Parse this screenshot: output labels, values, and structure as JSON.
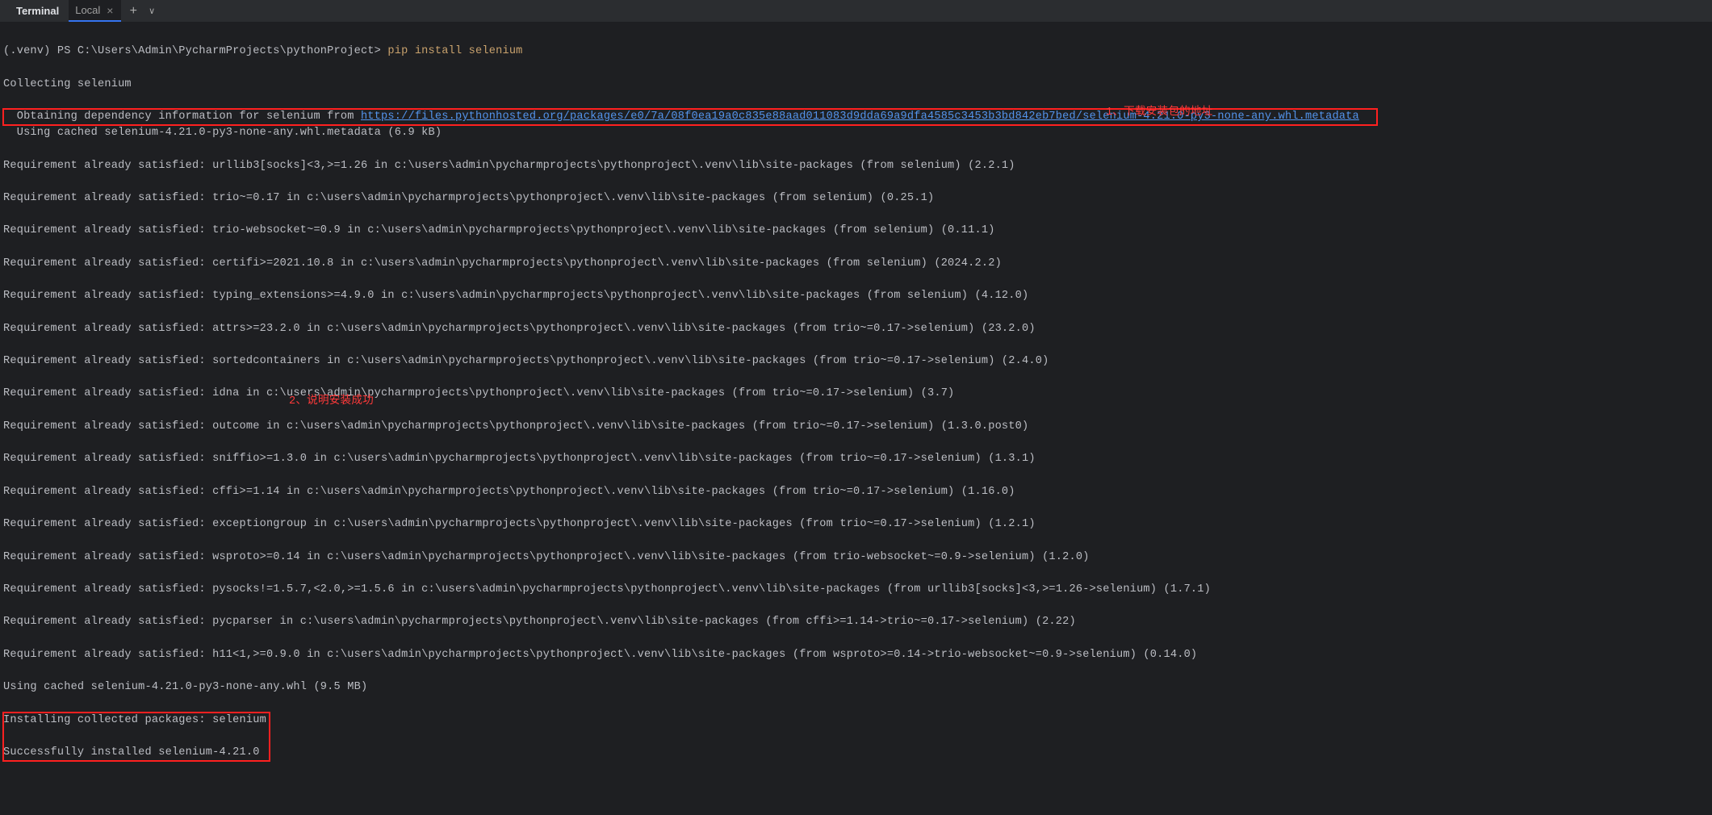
{
  "tabbar": {
    "title": "Terminal",
    "tab_label": "Local",
    "close_glyph": "×",
    "plus_glyph": "+",
    "chevron_glyph": "∨"
  },
  "prompt": {
    "prefix": "(.venv) PS C:\\Users\\Admin\\PycharmProjects\\pythonProject> ",
    "command": "pip install selenium"
  },
  "lines": {
    "collecting": "Collecting selenium",
    "obtaining_prefix": "  Obtaining dependency information for selenium from ",
    "obtaining_url": "https://files.pythonhosted.org/packages/e0/7a/08f0ea19a0c835e88aad011083d9dda69a9dfa4585c3453b3bd842eb7bed/selenium-4.21.0-py3-none-any.whl.metadata",
    "using_cached_meta": "  Using cached selenium-4.21.0-py3-none-any.whl.metadata (6.9 kB)",
    "req": [
      "Requirement already satisfied: urllib3[socks]<3,>=1.26 in c:\\users\\admin\\pycharmprojects\\pythonproject\\.venv\\lib\\site-packages (from selenium) (2.2.1)",
      "Requirement already satisfied: trio~=0.17 in c:\\users\\admin\\pycharmprojects\\pythonproject\\.venv\\lib\\site-packages (from selenium) (0.25.1)",
      "Requirement already satisfied: trio-websocket~=0.9 in c:\\users\\admin\\pycharmprojects\\pythonproject\\.venv\\lib\\site-packages (from selenium) (0.11.1)",
      "Requirement already satisfied: certifi>=2021.10.8 in c:\\users\\admin\\pycharmprojects\\pythonproject\\.venv\\lib\\site-packages (from selenium) (2024.2.2)",
      "Requirement already satisfied: typing_extensions>=4.9.0 in c:\\users\\admin\\pycharmprojects\\pythonproject\\.venv\\lib\\site-packages (from selenium) (4.12.0)",
      "Requirement already satisfied: attrs>=23.2.0 in c:\\users\\admin\\pycharmprojects\\pythonproject\\.venv\\lib\\site-packages (from trio~=0.17->selenium) (23.2.0)",
      "Requirement already satisfied: sortedcontainers in c:\\users\\admin\\pycharmprojects\\pythonproject\\.venv\\lib\\site-packages (from trio~=0.17->selenium) (2.4.0)",
      "Requirement already satisfied: idna in c:\\users\\admin\\pycharmprojects\\pythonproject\\.venv\\lib\\site-packages (from trio~=0.17->selenium) (3.7)",
      "Requirement already satisfied: outcome in c:\\users\\admin\\pycharmprojects\\pythonproject\\.venv\\lib\\site-packages (from trio~=0.17->selenium) (1.3.0.post0)",
      "Requirement already satisfied: sniffio>=1.3.0 in c:\\users\\admin\\pycharmprojects\\pythonproject\\.venv\\lib\\site-packages (from trio~=0.17->selenium) (1.3.1)",
      "Requirement already satisfied: cffi>=1.14 in c:\\users\\admin\\pycharmprojects\\pythonproject\\.venv\\lib\\site-packages (from trio~=0.17->selenium) (1.16.0)",
      "Requirement already satisfied: exceptiongroup in c:\\users\\admin\\pycharmprojects\\pythonproject\\.venv\\lib\\site-packages (from trio~=0.17->selenium) (1.2.1)",
      "Requirement already satisfied: wsproto>=0.14 in c:\\users\\admin\\pycharmprojects\\pythonproject\\.venv\\lib\\site-packages (from trio-websocket~=0.9->selenium) (1.2.0)",
      "Requirement already satisfied: pysocks!=1.5.7,<2.0,>=1.5.6 in c:\\users\\admin\\pycharmprojects\\pythonproject\\.venv\\lib\\site-packages (from urllib3[socks]<3,>=1.26->selenium) (1.7.1)",
      "Requirement already satisfied: pycparser in c:\\users\\admin\\pycharmprojects\\pythonproject\\.venv\\lib\\site-packages (from cffi>=1.14->trio~=0.17->selenium) (2.22)",
      "Requirement already satisfied: h11<1,>=0.9.0 in c:\\users\\admin\\pycharmprojects\\pythonproject\\.venv\\lib\\site-packages (from wsproto>=0.14->trio-websocket~=0.9->selenium) (0.14.0)"
    ],
    "using_cached_whl": "Using cached selenium-4.21.0-py3-none-any.whl (9.5 MB)",
    "installing": "Installing collected packages: selenium",
    "success": "Successfully installed selenium-4.21.0"
  },
  "annotations": {
    "a1": "1、下载安装包的地址",
    "a2": "2、说明安装成功"
  }
}
